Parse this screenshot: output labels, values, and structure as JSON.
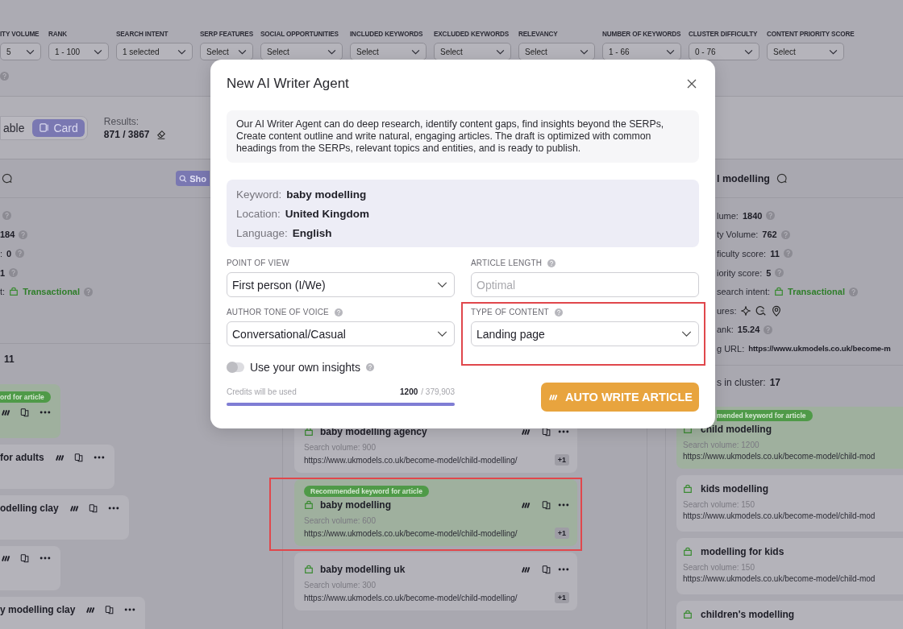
{
  "filters": [
    {
      "label": "ITY VOLUME",
      "value": "5"
    },
    {
      "label": "RANK",
      "value": "1 - 100"
    },
    {
      "label": "SEARCH INTENT",
      "value": "1 selected"
    },
    {
      "label": "SERP FEATURES",
      "value": "Select"
    },
    {
      "label": "SOCIAL OPPORTUNITIES",
      "value": "Select"
    },
    {
      "label": "INCLUDED KEYWORDS",
      "value": "Select"
    },
    {
      "label": "EXCLUDED KEYWORDS",
      "value": "Select"
    },
    {
      "label": "RELEVANCY",
      "value": "Select"
    },
    {
      "label": "NUMBER OF KEYWORDS",
      "value": "1 - 66"
    },
    {
      "label": "CLUSTER DIFFICULTY",
      "value": "0 - 76"
    },
    {
      "label": "CONTENT PRIORITY SCORE",
      "value": "Select"
    }
  ],
  "view_toggle": [
    {
      "label": "able",
      "selected": false
    },
    {
      "label": "Card",
      "selected": true
    }
  ],
  "results": {
    "label": "Results:",
    "value": "871 / 3867"
  },
  "left_column": {
    "show_button": "Sho",
    "details": [
      {
        "kind": "help"
      },
      {
        "kind": "text",
        "value": "184",
        "help": true
      },
      {
        "kind": "text",
        "label": ":",
        "value": "0",
        "help": true
      },
      {
        "kind": "text",
        "value": "1",
        "help": true
      },
      {
        "kind": "intent",
        "label": "t:",
        "value": "Transactional",
        "help": true
      }
    ],
    "count": "11",
    "cards": [
      {
        "badge": "ord for article",
        "recommended": true
      },
      {
        "title": "for adults",
        "recommended": false
      },
      {
        "title": "odelling clay",
        "recommended": false
      },
      {
        "recommended": false
      },
      {
        "title": "y modelling clay",
        "recommended": false
      }
    ]
  },
  "center_column": {
    "cards": [
      {
        "title": "baby modelling agency",
        "volume": "Search volume: 900",
        "url": "https://www.ukmodels.co.uk/become-model/child-modelling/",
        "more": "+1",
        "recommended": false,
        "highlighted": false
      },
      {
        "badge": "Recommended keyword for article",
        "title": "baby modelling",
        "volume": "Search volume: 600",
        "url": "https://www.ukmodels.co.uk/become-model/child-modelling/",
        "more": "+1",
        "recommended": true,
        "highlighted": true
      },
      {
        "title": "baby modelling uk",
        "volume": "Search volume: 300",
        "url": "https://www.ukmodels.co.uk/become-model/child-modelling/",
        "more": "+1",
        "recommended": false,
        "highlighted": false
      }
    ]
  },
  "right_column": {
    "title": "l modelling",
    "details": [
      {
        "kind": "text",
        "label": "lume:",
        "value": "1840",
        "help": true
      },
      {
        "kind": "text",
        "label": "ty Volume:",
        "value": "762",
        "help": true
      },
      {
        "kind": "text",
        "label": "ficulty score:",
        "value": "11",
        "help": true
      },
      {
        "kind": "text",
        "label": "iority score:",
        "value": "5",
        "help": true
      },
      {
        "kind": "intent",
        "label": "search intent:",
        "value": "Transactional",
        "help": true
      },
      {
        "kind": "features",
        "label": "ures:",
        "help": false
      },
      {
        "kind": "text",
        "label": "ank:",
        "value": "15.24",
        "help": true
      },
      {
        "kind": "url",
        "label": "g URL:",
        "value": "https://www.ukmodels.co.uk/become-m",
        "help": false
      }
    ],
    "count_label": "s in cluster:",
    "count": "17",
    "cards": [
      {
        "badge": "mended keyword for article",
        "title": "child modelling",
        "volume": "Search volume: 1200",
        "url": "https://www.ukmodels.co.uk/become-model/child-mod",
        "recommended": true
      },
      {
        "title": "kids modelling",
        "volume": "Search volume: 150",
        "url": "https://www.ukmodels.co.uk/become-model/child-mod",
        "recommended": false
      },
      {
        "title": "modelling for kids",
        "volume": "Search volume: 150",
        "url": "https://www.ukmodels.co.uk/become-model/child-mod",
        "recommended": false
      },
      {
        "title": "children's modelling",
        "recommended": false
      }
    ]
  },
  "modal": {
    "title": "New AI Writer Agent",
    "description": "Our AI Writer Agent can do deep research, identify content gaps, find insights beyond the SERPs, Create content outline and write natural, engaging articles. The draft is optimized with common headings from the SERPs, relevant topics and entities, and is ready to publish.",
    "info": [
      {
        "label": "Keyword:",
        "value": "baby modelling"
      },
      {
        "label": "Location:",
        "value": "United Kingdom"
      },
      {
        "label": "Language:",
        "value": "English"
      }
    ],
    "fields": [
      {
        "kind": "select",
        "label": "POINT OF VIEW",
        "value": "First person (I/We)",
        "help": false,
        "highlighted": false
      },
      {
        "kind": "input",
        "label": "ARTICLE LENGTH",
        "placeholder": "Optimal",
        "help": true,
        "highlighted": false
      },
      {
        "kind": "select",
        "label": "AUTHOR TONE OF VOICE",
        "value": "Conversational/Casual",
        "help": true,
        "highlighted": false
      },
      {
        "kind": "select",
        "label": "TYPE OF CONTENT",
        "value": "Landing page",
        "help": true,
        "highlighted": true
      }
    ],
    "insights_toggle": {
      "label": "Use your own insights",
      "on": false
    },
    "credits": {
      "label": "Credits will be used",
      "used": "1200",
      "total": "/ 379,903",
      "level": 1.0
    },
    "submit": "AUTO WRITE ARTICLE"
  }
}
